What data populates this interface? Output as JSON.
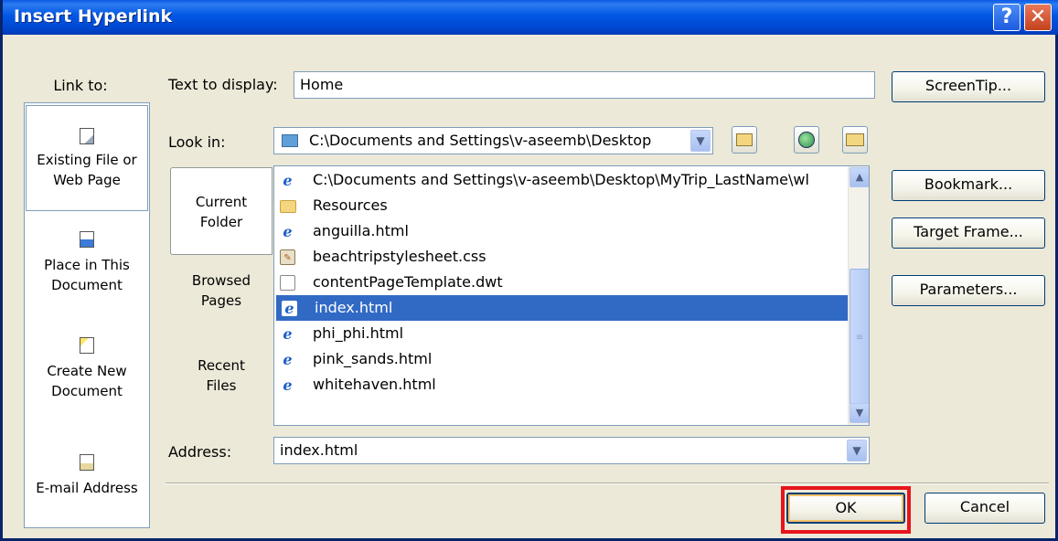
{
  "window": {
    "title": "Insert Hyperlink",
    "help_glyph": "?",
    "close_glyph": "✕"
  },
  "link_to": {
    "label": "Link to:",
    "items": [
      {
        "icon": "existing-file-icon",
        "label_line1": "Existing File or",
        "label_line2": "Web Page",
        "selected": true
      },
      {
        "icon": "place-in-document-icon",
        "label_line1": "Place in This",
        "label_line2": "Document",
        "selected": false
      },
      {
        "icon": "create-new-document-icon",
        "label_line1": "Create New",
        "label_line2": "Document",
        "selected": false
      },
      {
        "icon": "email-address-icon",
        "label_line1": "E-mail Address",
        "label_line2": "",
        "selected": false
      }
    ]
  },
  "text_to_display": {
    "label": "Text to display:",
    "value": "Home"
  },
  "screentip_label": "ScreenTip...",
  "look_in": {
    "label": "Look in:",
    "value": "C:\\Documents and Settings\\v-aseemb\\Desktop"
  },
  "tabs": [
    {
      "line1": "Current",
      "line2": "Folder",
      "selected": true
    },
    {
      "line1": "Browsed",
      "line2": "Pages",
      "selected": false
    },
    {
      "line1": "Recent",
      "line2": "Files",
      "selected": false
    }
  ],
  "files": [
    {
      "name": "C:\\Documents and Settings\\v-aseemb\\Desktop\\MyTrip_LastName\\wl",
      "icon": "ie-icon",
      "selected": false
    },
    {
      "name": "Resources",
      "icon": "folder-icon",
      "selected": false
    },
    {
      "name": "anguilla.html",
      "icon": "ie-icon",
      "selected": false
    },
    {
      "name": "beachtripstylesheet.css",
      "icon": "css-file-icon",
      "selected": false
    },
    {
      "name": "contentPageTemplate.dwt",
      "icon": "template-file-icon",
      "selected": false
    },
    {
      "name": "index.html",
      "icon": "ie-icon",
      "selected": true
    },
    {
      "name": "phi_phi.html",
      "icon": "ie-icon",
      "selected": false
    },
    {
      "name": "pink_sands.html",
      "icon": "ie-icon",
      "selected": false
    },
    {
      "name": "whitehaven.html",
      "icon": "ie-icon",
      "selected": false
    }
  ],
  "side_buttons": {
    "bookmark": "Bookmark...",
    "target_frame": "Target Frame...",
    "parameters": "Parameters..."
  },
  "address": {
    "label": "Address:",
    "value": "index.html"
  },
  "ok_label": "OK",
  "cancel_label": "Cancel",
  "colors": {
    "selection": "#316AC5",
    "title_bar": "#0054E3",
    "highlight_box": "#E8141C"
  }
}
